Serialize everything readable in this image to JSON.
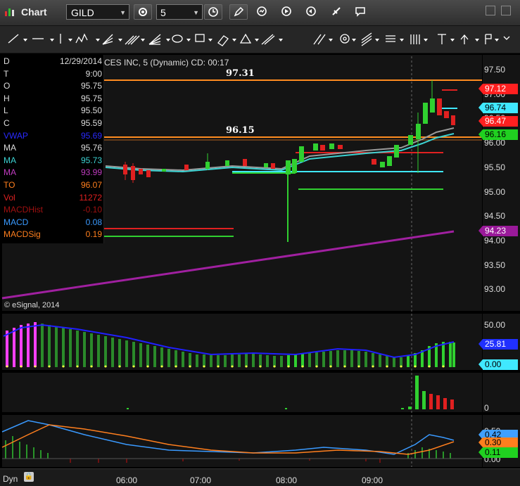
{
  "window": {
    "title": "Chart"
  },
  "toolbar": {
    "symbol": "GILD",
    "interval": "5"
  },
  "study_title": "CES INC, 5 (Dynamic) CD: 00:17",
  "levels": {
    "upper": "97.31",
    "lower": "96.15"
  },
  "info_panel": [
    {
      "key": "D",
      "value": "12/29/2014",
      "color": "#dddddd"
    },
    {
      "key": "T",
      "value": "9:00",
      "color": "#dddddd"
    },
    {
      "key": "O",
      "value": "95.75",
      "color": "#dddddd"
    },
    {
      "key": "H",
      "value": "95.75",
      "color": "#dddddd"
    },
    {
      "key": "L",
      "value": "95.50",
      "color": "#dddddd"
    },
    {
      "key": "C",
      "value": "95.59",
      "color": "#dddddd"
    },
    {
      "key": "VWAP",
      "value": "95.69",
      "color": "#2a2aff"
    },
    {
      "key": "MA",
      "value": "95.76",
      "color": "#dddddd"
    },
    {
      "key": "MA",
      "value": "95.73",
      "color": "#3cd2d2"
    },
    {
      "key": "MA",
      "value": "93.99",
      "color": "#c03cc0"
    },
    {
      "key": "TO",
      "value": "96.07",
      "color": "#ff7f1e"
    },
    {
      "key": "Vol",
      "value": "11272",
      "color": "#e02020"
    },
    {
      "key": "MACDHist",
      "value": "-0.10",
      "color": "#a01010"
    },
    {
      "key": "MACD",
      "value": "0.08",
      "color": "#3a9aff"
    },
    {
      "key": "MACDSig",
      "value": "0.19",
      "color": "#ff7f1e"
    }
  ],
  "price_axis": [
    "97.50",
    "97.00",
    "96.50",
    "96.00",
    "95.50",
    "95.00",
    "94.50",
    "94.00",
    "93.50",
    "93.00"
  ],
  "price_tags": [
    {
      "value": "97.12",
      "bg": "#ff2020",
      "fg": "#ffffff"
    },
    {
      "value": "96.74",
      "bg": "#40e8ff",
      "fg": "#000000"
    },
    {
      "value": "96.47",
      "bg": "#ff2020",
      "fg": "#ffffff"
    },
    {
      "value": "96.16",
      "bg": "#20d020",
      "fg": "#000000"
    },
    {
      "value": "94.23",
      "bg": "#9a1a9a",
      "fg": "#ffffff"
    }
  ],
  "osc1_axis": [
    "50.00",
    "0.00"
  ],
  "osc1_tags": [
    {
      "value": "25.81",
      "bg": "#2030ff",
      "fg": "#ffffff"
    },
    {
      "value": "0.00",
      "bg": "#40e8ff",
      "fg": "#000000"
    }
  ],
  "osc2_axis": [
    "0"
  ],
  "osc3_axis": [
    "0.50",
    "0.00"
  ],
  "osc3_tags": [
    {
      "value": "0.42",
      "bg": "#40a0ff",
      "fg": "#000000"
    },
    {
      "value": "0.30",
      "bg": "#ff7f1e",
      "fg": "#000000"
    },
    {
      "value": "0.11",
      "bg": "#20d020",
      "fg": "#000000"
    }
  ],
  "copyright": "© eSignal, 2014",
  "time_axis": [
    "06:00",
    "07:00",
    "08:00",
    "09:00"
  ],
  "footer": {
    "mode": "Dyn"
  }
}
